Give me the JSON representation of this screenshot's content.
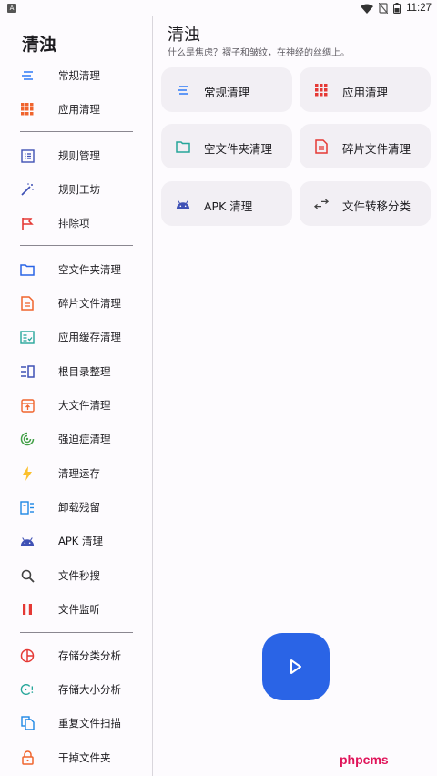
{
  "status_bar": {
    "time": "11:27",
    "left_badge": "A"
  },
  "drawer": {
    "title": "清浊",
    "items": [
      {
        "label": "常规清理",
        "icon": "list-lines-icon",
        "color": "#3b82f6"
      },
      {
        "label": "应用清理",
        "icon": "apps-grid-icon",
        "color": "#f0642d"
      },
      {
        "label": "规则管理",
        "icon": "list-alt-icon",
        "color": "#3f51b5"
      },
      {
        "label": "规则工坊",
        "icon": "magic-wand-icon",
        "color": "#3f51b5"
      },
      {
        "label": "排除项",
        "icon": "flag-icon",
        "color": "#e53935"
      },
      {
        "label": "空文件夹清理",
        "icon": "folder-icon",
        "color": "#2a64e6"
      },
      {
        "label": "碎片文件清理",
        "icon": "document-icon",
        "color": "#f0642d"
      },
      {
        "label": "应用缓存清理",
        "icon": "fact-check-icon",
        "color": "#26a69a"
      },
      {
        "label": "根目录整理",
        "icon": "view-list-icon",
        "color": "#3f51b5"
      },
      {
        "label": "大文件清理",
        "icon": "archive-icon",
        "color": "#f0642d"
      },
      {
        "label": "强迫症清理",
        "icon": "target-icon",
        "color": "#43a047"
      },
      {
        "label": "清理运存",
        "icon": "bolt-icon",
        "color": "#fbc02d"
      },
      {
        "label": "卸载残留",
        "icon": "uninstall-icon",
        "color": "#1e88e5"
      },
      {
        "label": "APK 清理",
        "icon": "android-icon",
        "color": "#3f51b5"
      },
      {
        "label": "文件秒搜",
        "icon": "search-icon",
        "color": "#424242"
      },
      {
        "label": "文件监听",
        "icon": "pause-icon",
        "color": "#e53935"
      },
      {
        "label": "存储分类分析",
        "icon": "pie-chart-icon",
        "color": "#e53935"
      },
      {
        "label": "存储大小分析",
        "icon": "storage-size-icon",
        "color": "#26a69a"
      },
      {
        "label": "重复文件扫描",
        "icon": "copy-icon",
        "color": "#1e88e5"
      },
      {
        "label": "干掉文件夹",
        "icon": "lock-icon",
        "color": "#f0642d"
      }
    ]
  },
  "main": {
    "title": "清浊",
    "subtitle": "什么是焦虑？褶子和皱纹，在神经的丝绸上。",
    "cards": [
      {
        "label": "常规清理",
        "icon": "list-lines-icon",
        "color": "#3b82f6"
      },
      {
        "label": "应用清理",
        "icon": "apps-grid-icon",
        "color": "#e53935"
      },
      {
        "label": "空文件夹清理",
        "icon": "folder-icon",
        "color": "#26a69a"
      },
      {
        "label": "碎片文件清理",
        "icon": "document-icon",
        "color": "#e53935"
      },
      {
        "label": "APK 清理",
        "icon": "android-icon",
        "color": "#3f51b5"
      },
      {
        "label": "文件转移分类",
        "icon": "transfer-icon",
        "color": "#424242"
      }
    ]
  },
  "watermark": "phpcms",
  "accent": "#2a64e6"
}
